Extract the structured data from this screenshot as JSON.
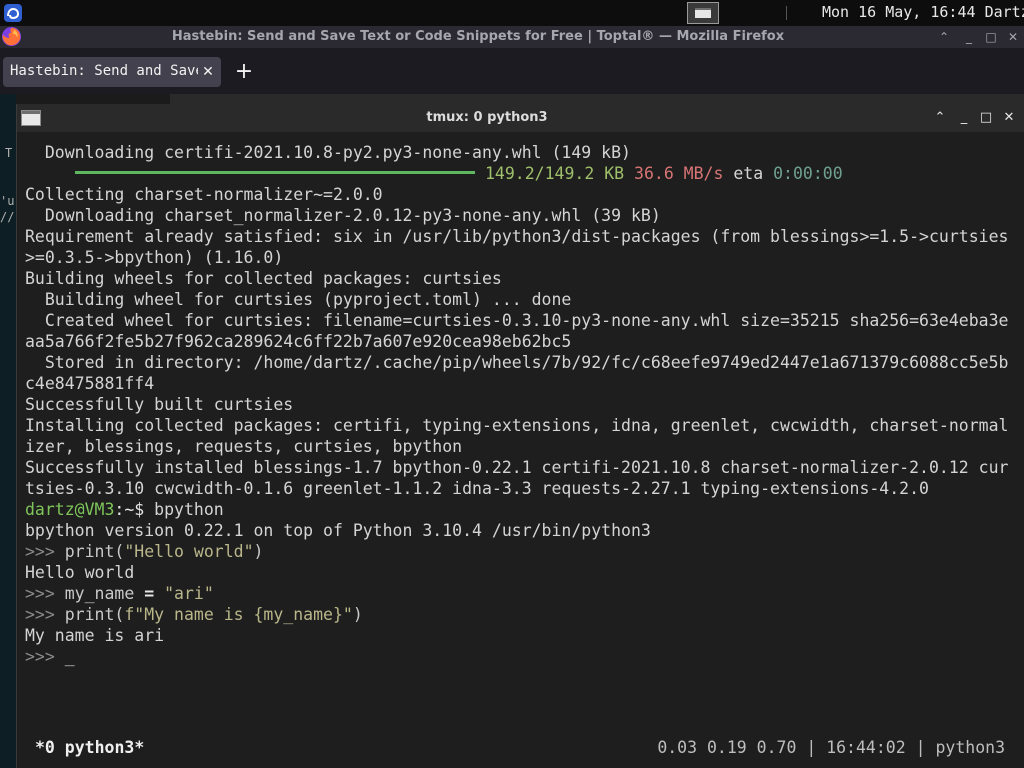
{
  "top_panel": {
    "clock": "Mon 16 May, 16:44",
    "user": "Dartz",
    "apps_icon": "desktop-apps-icon",
    "window_icon": "window-switcher-icon"
  },
  "firefox": {
    "window_title": "Hastebin: Send and Save Text or Code Snippets for Free | Toptal® — Mozilla Firefox",
    "tab_label": "Hastebin: Send and Save Text or Code Snippets for Free | Toptal®",
    "tab_close": "✕",
    "new_tab": "+",
    "icon": "firefox-icon"
  },
  "background_content": {
    "chars": [
      "T",
      "'u",
      "//"
    ]
  },
  "terminal": {
    "window_title": "tmux: 0 python3",
    "controls": {
      "minimize_up": "⌃",
      "minimize": "_",
      "maximize": "□",
      "close": "✕"
    },
    "lines": {
      "l1": "  Downloading certifi-2021.10.8-py2.py3-none-any.whl (149 kB)",
      "progress_size": "149.2/149.2 KB",
      "progress_speed": "36.6 MB/s",
      "progress_eta_label": "eta",
      "progress_eta": "0:00:00",
      "progress_fraction": 1.0,
      "l3": "Collecting charset-normalizer~=2.0.0",
      "l4": "  Downloading charset_normalizer-2.0.12-py3-none-any.whl (39 kB)",
      "l5": "Requirement already satisfied: six in /usr/lib/python3/dist-packages (from blessings>=1.5->curtsies",
      "l6": ">=0.3.5->bpython) (1.16.0)",
      "l7": "Building wheels for collected packages: curtsies",
      "l8": "  Building wheel for curtsies (pyproject.toml) ... done",
      "l9": "  Created wheel for curtsies: filename=curtsies-0.3.10-py3-none-any.whl size=35215 sha256=63e4eba3e",
      "l10": "aa5a766f2fe5b27f962ca289624c6ff22b7a607e920cea98eb62bc5",
      "l11": "  Stored in directory: /home/dartz/.cache/pip/wheels/7b/92/fc/c68eefe9749ed2447e1a671379c6088cc5e5b",
      "l12": "c4e8475881ff4",
      "l13": "Successfully built curtsies",
      "l14": "Installing collected packages: certifi, typing-extensions, idna, greenlet, cwcwidth, charset-normal",
      "l15": "izer, blessings, requests, curtsies, bpython",
      "l16": "Successfully installed blessings-1.7 bpython-0.22.1 certifi-2021.10.8 charset-normalizer-2.0.12 cur",
      "l17": "tsies-0.3.10 cwcwidth-0.1.6 greenlet-1.1.2 idna-3.3 requests-2.27.1 typing-extensions-4.2.0",
      "prompt_user": "dartz@VM3",
      "prompt_path": ":~$",
      "prompt_cmd": " bpython",
      "l19": "bpython version 0.22.1 on top of Python 3.10.4 /usr/bin/python3",
      "repl_prompt": ">>>",
      "r1_func": "print(",
      "r1_str": "\"Hello world\"",
      "r1_close": ")",
      "out1": "Hello world",
      "r2_ident": "my_name",
      "r2_eq": " = ",
      "r2_str": "\"ari\"",
      "r3_func": "print(",
      "r3_str": "f\"My name is {my_name}\"",
      "r3_close": ")",
      "out2": "My name is ari",
      "cursor": "_"
    },
    "status": {
      "left": "*0 python3*",
      "right": "0.03 0.19 0.70 | 16:44:02 | python3"
    }
  }
}
